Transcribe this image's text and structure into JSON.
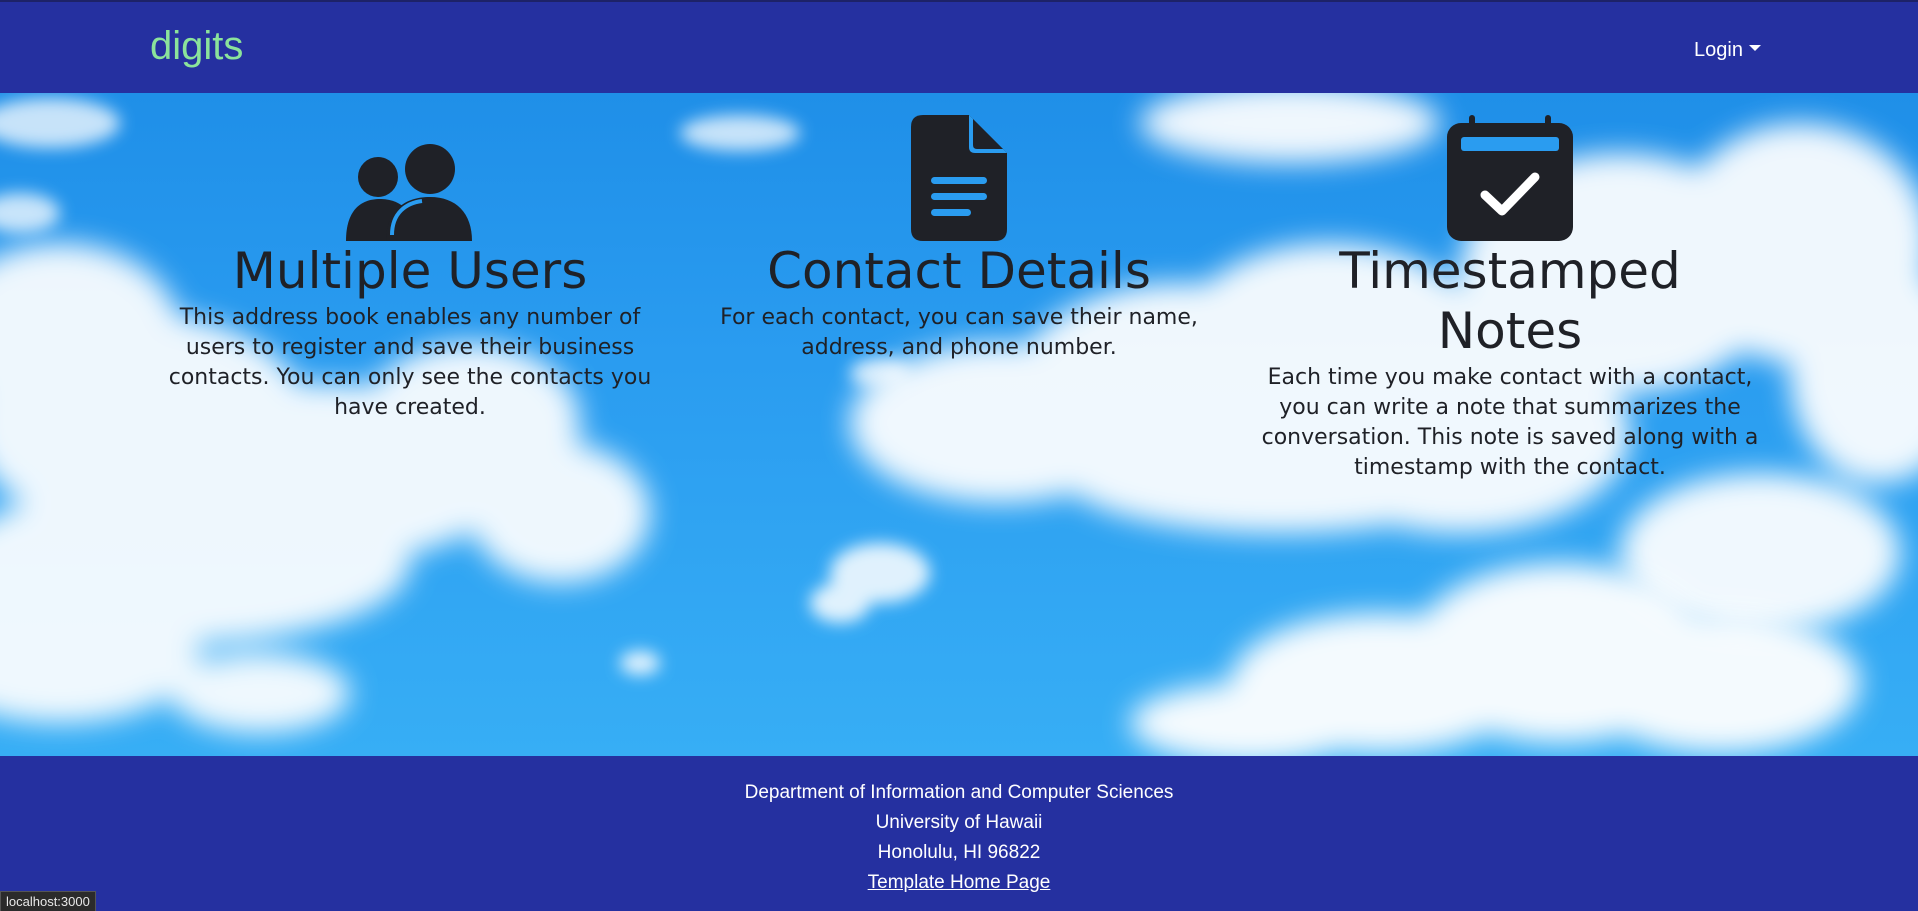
{
  "navbar": {
    "brand": "digits",
    "login_label": "Login"
  },
  "features": [
    {
      "icon": "users-icon",
      "title": "Multiple Users",
      "description": "This address book enables any number of users to register and save their business contacts. You can only see the contacts you have created."
    },
    {
      "icon": "file-lines-icon",
      "title": "Contact Details",
      "description": "For each contact, you can save their name, address, and phone number."
    },
    {
      "icon": "calendar-check-icon",
      "title": "Timestamped Notes",
      "description": "Each time you make contact with a contact, you can write a note that summarizes the conversation. This note is saved along with a timestamp with the contact."
    }
  ],
  "footer": {
    "line1": "Department of Information and Computer Sciences",
    "line2": "University of Hawaii",
    "line3": "Honolulu, HI 96822",
    "link_label": "Template Home Page"
  },
  "status_bar": {
    "url": "localhost:3000"
  },
  "colors": {
    "navbar_bg": "#2530a0",
    "brand": "#8be39b",
    "icon": "#1f2127"
  }
}
